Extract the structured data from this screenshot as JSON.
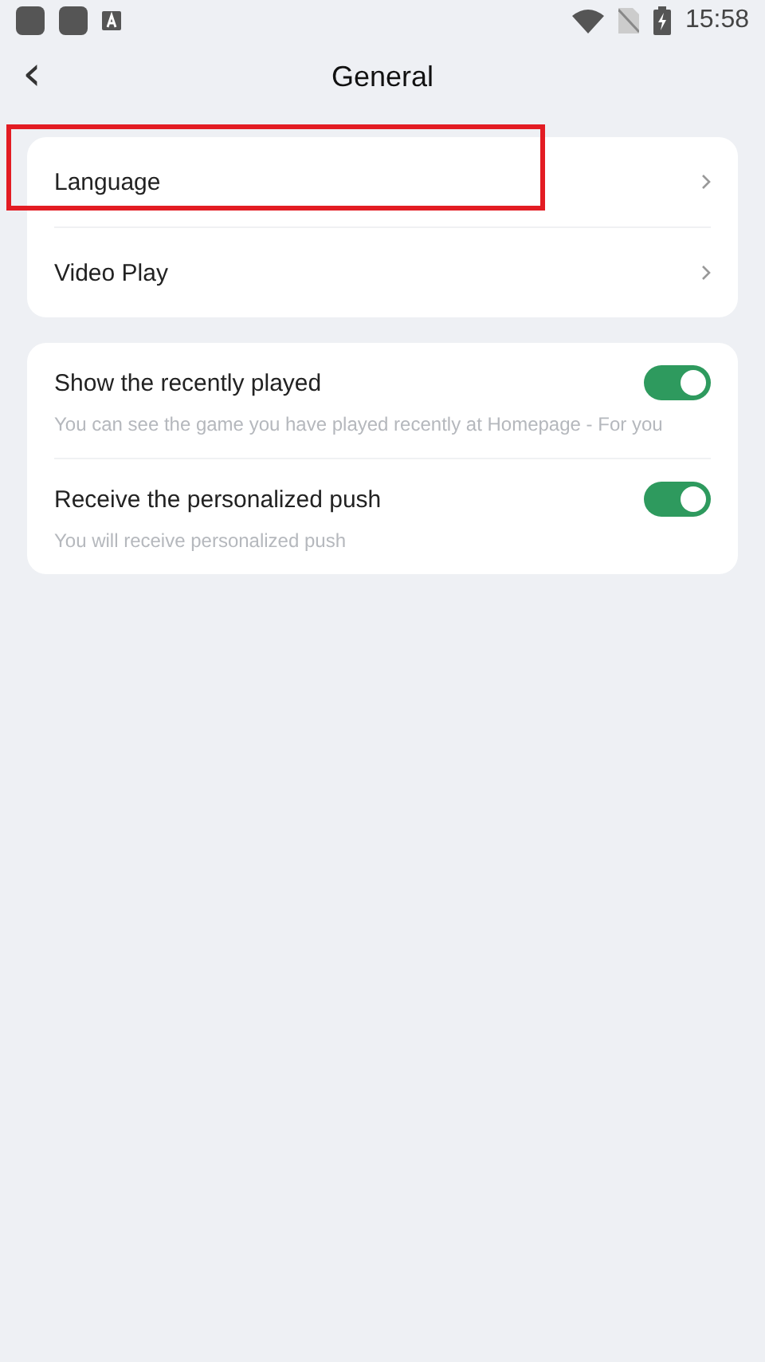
{
  "status_bar": {
    "time": "15:58"
  },
  "header": {
    "back": "‹",
    "title": "General"
  },
  "nav_items": [
    {
      "label": "Language",
      "highlighted": true
    },
    {
      "label": "Video Play",
      "highlighted": false
    }
  ],
  "toggles": [
    {
      "label": "Show the recently played",
      "description": "You can see the game you have played recently at Homepage - For you",
      "on": true
    },
    {
      "label": "Receive the personalized push",
      "description": "You will receive personalized push",
      "on": true
    }
  ]
}
